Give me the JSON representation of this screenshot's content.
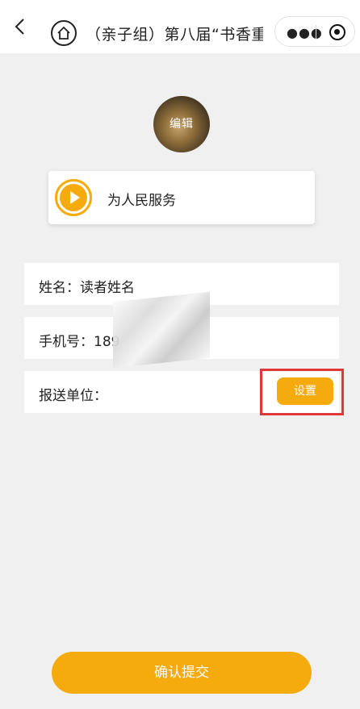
{
  "navbar": {
    "title": "（亲子组）第八届“书香重庆 阅读…",
    "more_icon": "more-dots-icon",
    "target_icon": "record-target-icon"
  },
  "avatar": {
    "edit_label": "编辑"
  },
  "audio": {
    "title": "为人民服务",
    "icon": "play-icon",
    "accent_color": "#f5ab0e"
  },
  "form": {
    "name_label": "姓名：",
    "name_value": "读者姓名",
    "phone_label": "手机号：",
    "phone_value": "189",
    "unit_label": "报送单位：",
    "settings_label": "设置"
  },
  "submit_label": "确认提交",
  "colors": {
    "accent": "#f5ab0e",
    "highlight": "#e0373a",
    "background": "#f0f0f0"
  }
}
